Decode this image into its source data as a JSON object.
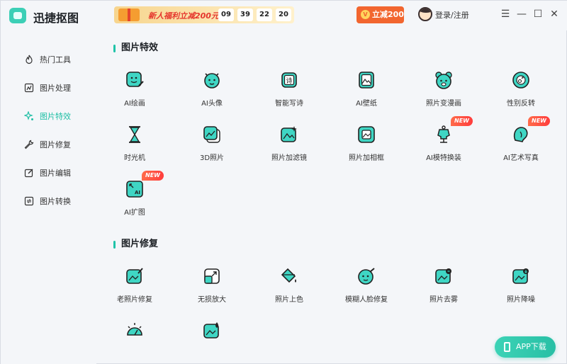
{
  "app": {
    "title": "迅捷抠图"
  },
  "promo": {
    "text": "新人福利立减200元",
    "countdown": [
      "09",
      "39",
      "22",
      "20"
    ]
  },
  "vip": {
    "label": "立减200",
    "icon_text": "V"
  },
  "account": {
    "login_label": "登录/注册"
  },
  "window_controls": {
    "menu": "☰",
    "minimize": "—",
    "maximize": "☐",
    "close": "✕"
  },
  "sidebar": {
    "items": [
      {
        "label": "热门工具",
        "icon": "flame-icon",
        "active": false
      },
      {
        "label": "图片处理",
        "icon": "image-edit-icon",
        "active": false
      },
      {
        "label": "图片特效",
        "icon": "sparkle-icon",
        "active": true
      },
      {
        "label": "图片修复",
        "icon": "wrench-icon",
        "active": false
      },
      {
        "label": "图片编辑",
        "icon": "pen-square-icon",
        "active": false
      },
      {
        "label": "图片转换",
        "icon": "convert-icon",
        "active": false
      }
    ]
  },
  "sections": {
    "effects": {
      "title": "图片特效",
      "tools": [
        {
          "label": "AI绘画",
          "icon": "ai-paint-icon"
        },
        {
          "label": "AI头像",
          "icon": "ai-avatar-icon"
        },
        {
          "label": "智能写诗",
          "icon": "poem-icon",
          "glyph": "诗"
        },
        {
          "label": "AI壁纸",
          "icon": "wallpaper-icon"
        },
        {
          "label": "照片变漫画",
          "icon": "comic-bear-icon"
        },
        {
          "label": "性别反转",
          "icon": "gender-swap-icon"
        },
        {
          "label": "时光机",
          "icon": "hourglass-icon"
        },
        {
          "label": "3D照片",
          "icon": "photo-3d-icon"
        },
        {
          "label": "照片加滤镜",
          "icon": "filter-icon"
        },
        {
          "label": "照片加相框",
          "icon": "frame-icon"
        },
        {
          "label": "AI模特换装",
          "icon": "mannequin-icon",
          "badge": "NEW"
        },
        {
          "label": "AI艺术写真",
          "icon": "art-portrait-icon",
          "badge": "NEW"
        },
        {
          "label": "AI扩图",
          "icon": "expand-icon",
          "badge": "NEW",
          "glyph": "AI"
        }
      ]
    },
    "repair": {
      "title": "图片修复",
      "tools": [
        {
          "label": "老照片修复",
          "icon": "old-photo-icon"
        },
        {
          "label": "无损放大",
          "icon": "upscale-icon"
        },
        {
          "label": "照片上色",
          "icon": "colorize-icon"
        },
        {
          "label": "模糊人脸修复",
          "icon": "face-repair-icon"
        },
        {
          "label": "照片去雾",
          "icon": "dehaze-icon"
        },
        {
          "label": "照片降噪",
          "icon": "denoise-icon"
        },
        {
          "label": "",
          "icon": "exposure-icon"
        },
        {
          "label": "",
          "icon": "photo-water-icon"
        }
      ]
    }
  },
  "app_download": {
    "label": "APP下载"
  },
  "colors": {
    "accent": "#1fc3a8",
    "icon_fill": "#3fd6c4",
    "badge": "#ff4a3d",
    "vip": "#f2662f"
  }
}
